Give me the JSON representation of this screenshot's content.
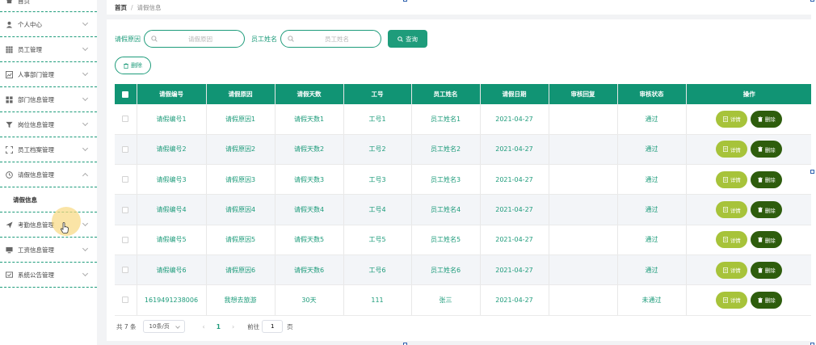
{
  "sidebar": {
    "items": [
      {
        "label": "首页"
      },
      {
        "label": "个人中心"
      },
      {
        "label": "员工管理"
      },
      {
        "label": "人事部门管理"
      },
      {
        "label": "部门信息管理"
      },
      {
        "label": "岗位信息管理"
      },
      {
        "label": "员工档案管理"
      },
      {
        "label": "请假信息管理"
      },
      {
        "label": "请假信息"
      },
      {
        "label": "考勤信息管理"
      },
      {
        "label": "工资信息管理"
      },
      {
        "label": "系统公告管理"
      }
    ]
  },
  "breadcrumb": {
    "home": "首页",
    "separator": "/",
    "current": "请假信息"
  },
  "search": {
    "reason_label": "请假原因",
    "reason_placeholder": "请假原因",
    "name_label": "员工姓名",
    "name_placeholder": "员工姓名",
    "button": "查询"
  },
  "toolbar": {
    "delete_label": "删除"
  },
  "table": {
    "headers": [
      "请假编号",
      "请假原因",
      "请假天数",
      "工号",
      "员工姓名",
      "请假日期",
      "审核回复",
      "审核状态",
      "操作"
    ],
    "rows": [
      [
        "请假编号1",
        "请假原因1",
        "请假天数1",
        "工号1",
        "员工姓名1",
        "2021-04-27",
        "",
        "通过"
      ],
      [
        "请假编号2",
        "请假原因2",
        "请假天数2",
        "工号2",
        "员工姓名2",
        "2021-04-27",
        "",
        "通过"
      ],
      [
        "请假编号3",
        "请假原因3",
        "请假天数3",
        "工号3",
        "员工姓名3",
        "2021-04-27",
        "",
        "通过"
      ],
      [
        "请假编号4",
        "请假原因4",
        "请假天数4",
        "工号4",
        "员工姓名4",
        "2021-04-27",
        "",
        "通过"
      ],
      [
        "请假编号5",
        "请假原因5",
        "请假天数5",
        "工号5",
        "员工姓名5",
        "2021-04-27",
        "",
        "通过"
      ],
      [
        "请假编号6",
        "请假原因6",
        "请假天数6",
        "工号6",
        "员工姓名6",
        "2021-04-27",
        "",
        "通过"
      ],
      [
        "1619491238006",
        "我想去旅游",
        "30天",
        "111",
        "张三",
        "2021-04-27",
        "",
        "未通过"
      ]
    ],
    "detail_label": "详情",
    "delete_label": "删除"
  },
  "pagination": {
    "total": "共 7 条",
    "page_size": "10条/页",
    "current_page": "1",
    "goto_label": "前往",
    "goto_value": "1",
    "page_suffix": "页"
  },
  "colors": {
    "accent": "#1e9c7b",
    "header": "#119474",
    "detail": "#a7c33a",
    "delete": "#2e5d0d"
  }
}
